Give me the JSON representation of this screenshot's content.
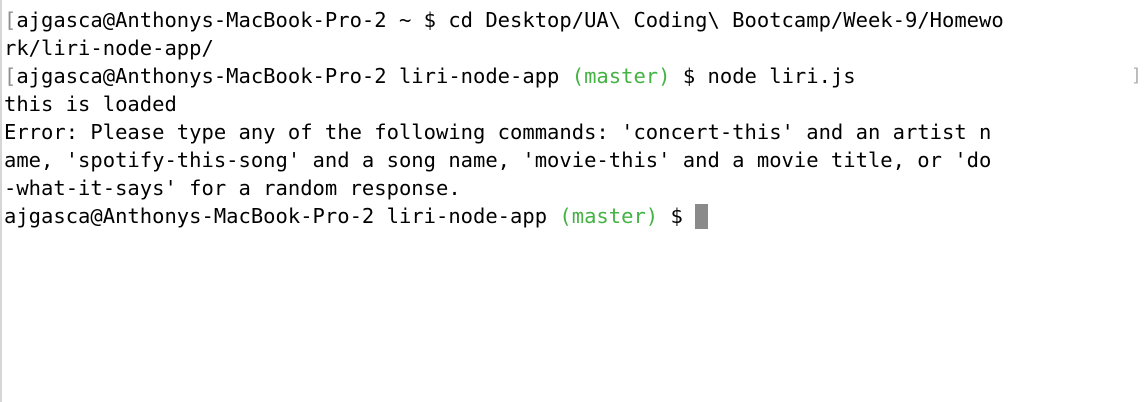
{
  "terminal": {
    "lines": [
      {
        "bracket": "[",
        "text": "ajgasca@Anthonys-MacBook-Pro-2 ~ $ cd Desktop/UA\\ Coding\\ Bootcamp/Week-9/Homewo"
      },
      {
        "text": "rk/liri-node-app/"
      },
      {
        "bracket": "[",
        "prompt": "ajgasca@Anthonys-MacBook-Pro-2 liri-node-app",
        "branch": "(master)",
        "rest": "$ node liri.js"
      },
      {
        "text": "this is loaded"
      },
      {
        "text": "Error: Please type any of the following commands: 'concert-this' and an artist n"
      },
      {
        "text": "ame, 'spotify-this-song' and a song name, 'movie-this' and a movie title, or 'do"
      },
      {
        "text": "-what-it-says' for a random response."
      },
      {
        "prompt": "ajgasca@Anthonys-MacBook-Pro-2 liri-node-app",
        "branch": "(master)",
        "rest": "$"
      }
    ],
    "right_bracket": "]"
  },
  "colors": {
    "background": "#ffffff",
    "text": "#000000",
    "branch": "#44b244",
    "bracket": "#8f8f8f",
    "cursor": "#8a8a8a"
  }
}
